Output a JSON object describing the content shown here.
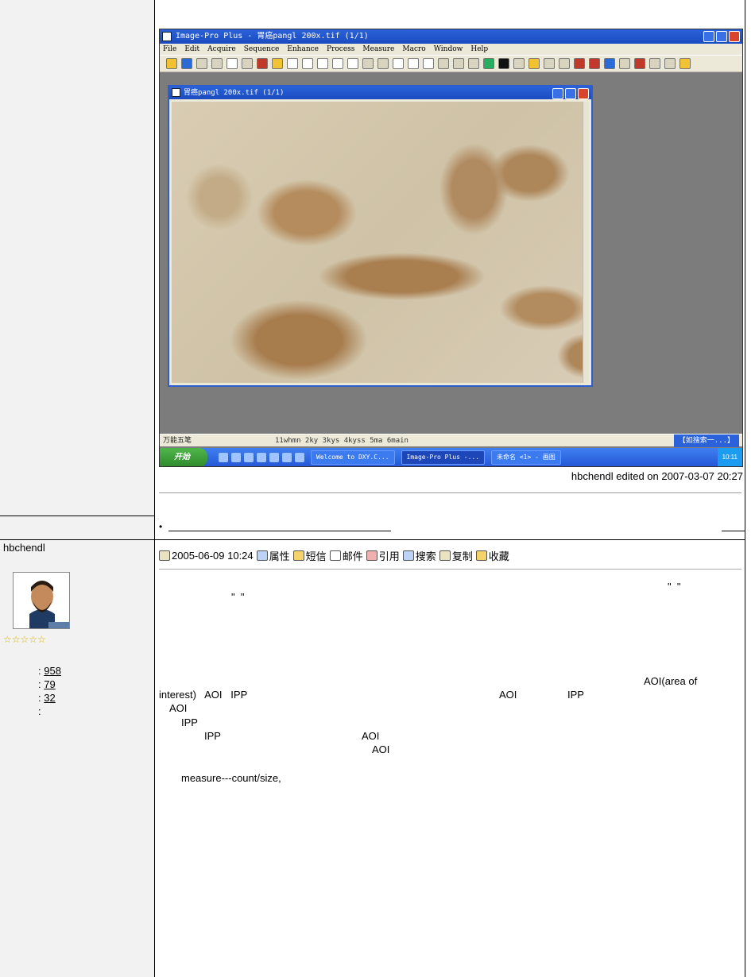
{
  "ipp": {
    "title": "Image-Pro Plus - 胃癌pangl  200x.tif (1/1)",
    "menu": [
      "File",
      "Edit",
      "Acquire",
      "Sequence",
      "Enhance",
      "Process",
      "Measure",
      "Macro",
      "Window",
      "Help"
    ],
    "image_window_title": "胃癌pangl  200x.tif (1/1)",
    "status_left": "万能五笔",
    "status_mid": "11whmn 2ky 3kys 4kyss 5ma 6main",
    "status_right": "【如搜索一...】",
    "taskbar": {
      "start": "开始",
      "items": [
        "Welcome to DXY.C...",
        "Image-Pro Plus -...",
        "未命名 <1> - 画图"
      ],
      "clock": "10:11"
    }
  },
  "post1": {
    "edited": "hbchendl edited on 2007-03-07 20:27",
    "bullet": "•"
  },
  "post2": {
    "author": "hbchendl",
    "stars": "☆☆☆☆☆",
    "stats": [
      {
        "label": ":",
        "value": "958"
      },
      {
        "label": ":",
        "value": "79"
      },
      {
        "label": ":",
        "value": "32"
      },
      {
        "label": ":",
        "value": ""
      }
    ],
    "date": "2005-06-09 10:24",
    "actions": [
      "属性",
      "短信",
      "邮件",
      "引用",
      "搜索",
      "复制",
      "收藏"
    ],
    "body": {
      "q1": "\"  \"",
      "q2": "\"  \"",
      "aoi_area": "AOI(area of",
      "interest": "interest)   AOI   IPP",
      "aoi_mid": "AOI",
      "ipp_mid": "IPP",
      "aoi_line": "AOI",
      "ipp_line": "IPP",
      "ipp_line2": "IPP",
      "aoi_line2": "AOI",
      "aoi_line3": "AOI",
      "measure": "measure---count/size,"
    }
  }
}
